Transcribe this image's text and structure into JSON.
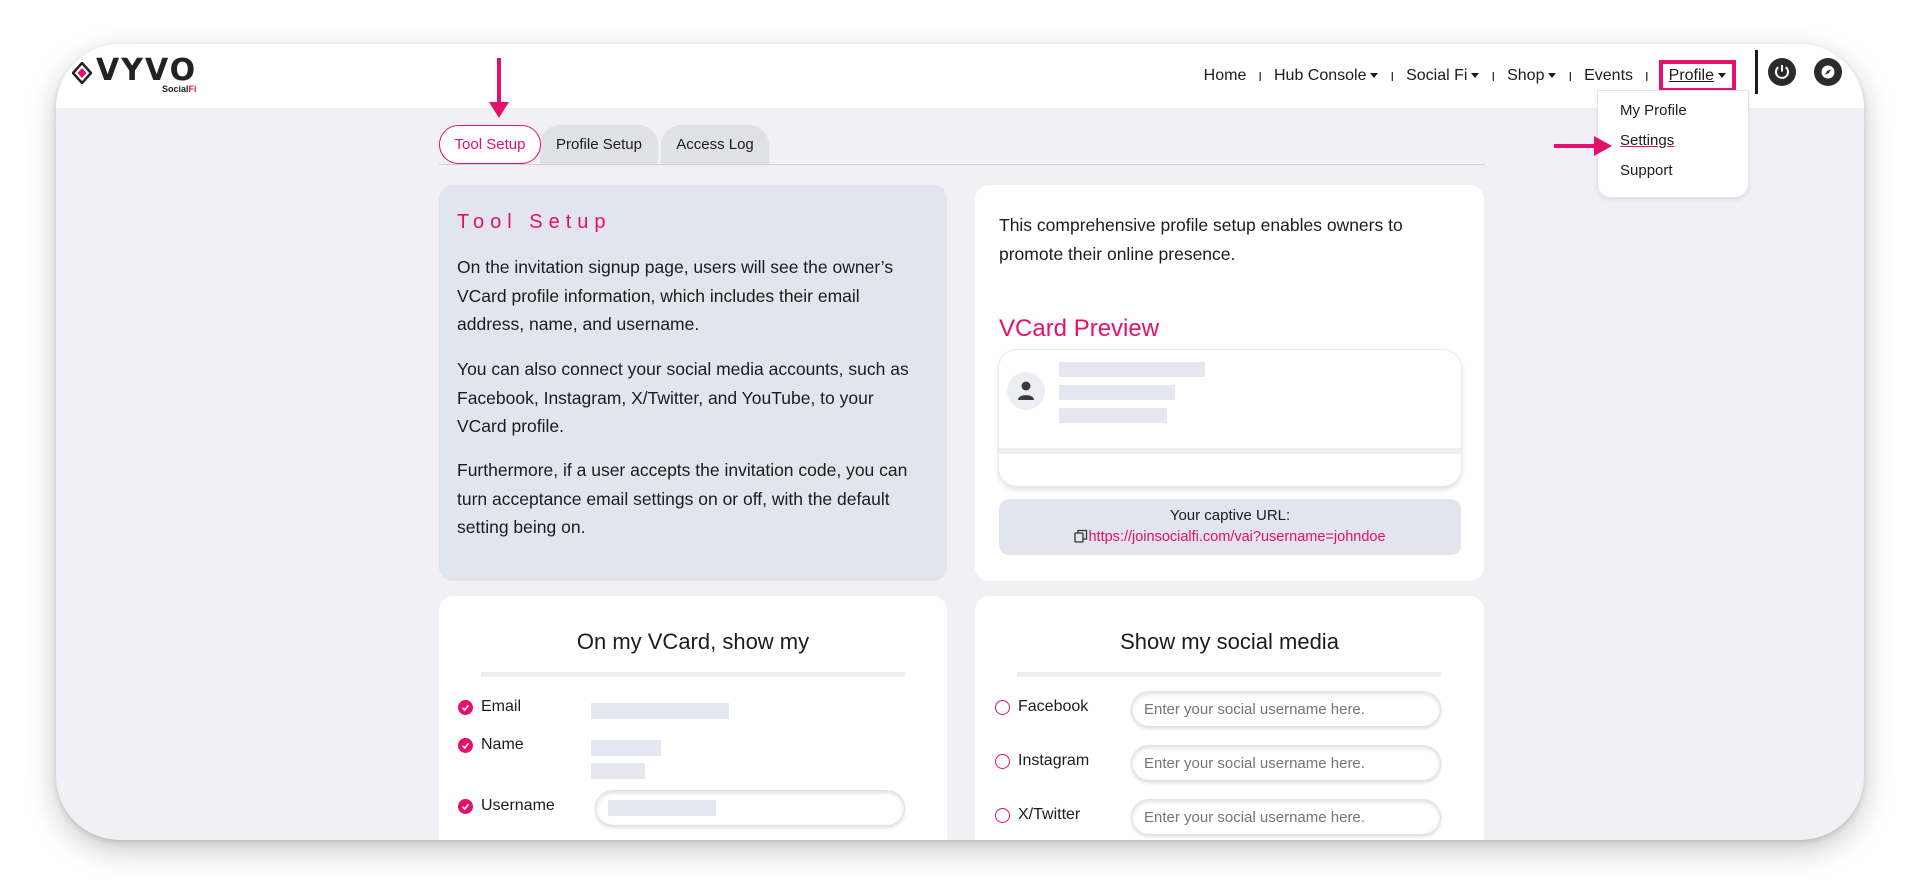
{
  "brand": {
    "logo_text": "VYVO",
    "logo_sub_a": "Social",
    "logo_sub_b": "Fi",
    "accent": "#e5106b"
  },
  "nav": {
    "home": "Home",
    "hub_console": "Hub Console",
    "social_fi": "Social Fi",
    "shop": "Shop",
    "events": "Events",
    "profile": "Profile",
    "icons": [
      "power-icon",
      "compass-icon"
    ]
  },
  "profile_menu": {
    "items": [
      "My Profile",
      "Settings",
      "Support"
    ]
  },
  "tabs": [
    "Tool Setup",
    "Profile Setup",
    "Access Log"
  ],
  "tool_setup": {
    "title": "Tool Setup",
    "paragraphs": [
      "On the invitation signup page, users will see the owner’s VCard profile information, which includes their email address, name, and username.",
      "You can also connect your social media accounts, such as Facebook, Instagram, X/Twitter, and YouTube, to your VCard profile.",
      "Furthermore, if a user accepts the invitation code, you can turn acceptance email settings on or off, with the default setting being on."
    ]
  },
  "preview": {
    "intro": "This comprehensive profile setup enables owners to promote their online presence.",
    "vcard_title": "VCard Preview",
    "captive_label": "Your captive URL:",
    "captive_url": "https://joinsocialfi.com/vai?username=",
    "captive_user": "johndoe"
  },
  "vcard_show": {
    "title": "On my VCard, show my",
    "fields": [
      "Email",
      "Name",
      "Username"
    ]
  },
  "social_media": {
    "title": "Show my social media",
    "networks": [
      "Facebook",
      "Instagram",
      "X/Twitter"
    ],
    "placeholder": "Enter your social username here."
  }
}
